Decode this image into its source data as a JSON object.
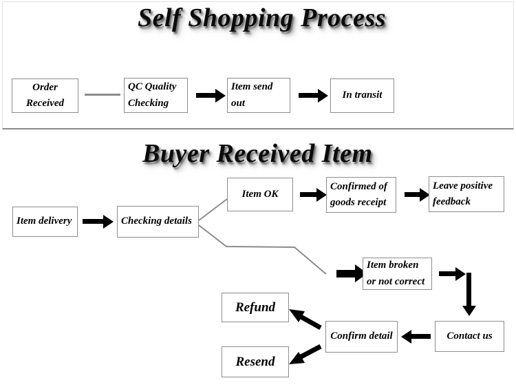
{
  "document": {
    "type": "flowchart-diagram",
    "background_color": "#ffffff",
    "box_border_color": "#8d8d8d",
    "arrow_color": "#000000",
    "connector_color": "#8b8b8b"
  },
  "sections": [
    {
      "id": "self-shopping-process",
      "title": "Self Shopping Process",
      "nodes": [
        {
          "id": "order-received",
          "lines": [
            "Order",
            "Received"
          ],
          "align": "center"
        },
        {
          "id": "qc-quality-checking",
          "lines": [
            "QC Quality",
            "Checking"
          ],
          "align": "left"
        },
        {
          "id": "item-send-out",
          "lines": [
            "Item send",
            "out"
          ],
          "align": "left"
        },
        {
          "id": "in-transit",
          "lines": [
            "In transit"
          ],
          "align": "center"
        }
      ],
      "flow": [
        {
          "from": "order-received",
          "to": "qc-quality-checking",
          "style": "plain-line"
        },
        {
          "from": "qc-quality-checking",
          "to": "item-send-out",
          "style": "arrow"
        },
        {
          "from": "item-send-out",
          "to": "in-transit",
          "style": "arrow"
        }
      ]
    },
    {
      "id": "buyer-received-item",
      "title": "Buyer Received Item",
      "nodes": [
        {
          "id": "item-delivery",
          "lines": [
            "Item delivery"
          ],
          "align": "left"
        },
        {
          "id": "checking-details",
          "lines": [
            "Checking details"
          ],
          "align": "left"
        },
        {
          "id": "item-ok",
          "lines": [
            "Item OK"
          ],
          "align": "center"
        },
        {
          "id": "confirmed-receipt",
          "lines": [
            "Confirmed of",
            "goods receipt"
          ],
          "align": "left"
        },
        {
          "id": "leave-feedback",
          "lines": [
            "Leave positive",
            "feedback"
          ],
          "align": "left"
        },
        {
          "id": "item-broken",
          "lines": [
            "Item broken",
            "or not correct"
          ],
          "align": "left"
        },
        {
          "id": "contact-us",
          "lines": [
            "Contact us"
          ],
          "align": "center"
        },
        {
          "id": "confirm-detail",
          "lines": [
            "Confirm detail"
          ],
          "align": "center"
        },
        {
          "id": "refund",
          "lines": [
            "Refund"
          ],
          "align": "center"
        },
        {
          "id": "resend",
          "lines": [
            "Resend"
          ],
          "align": "center"
        }
      ],
      "flow": [
        {
          "from": "item-delivery",
          "to": "checking-details",
          "style": "arrow"
        },
        {
          "from": "checking-details",
          "to": "item-ok",
          "style": "plain-line"
        },
        {
          "from": "item-ok",
          "to": "confirmed-receipt",
          "style": "arrow"
        },
        {
          "from": "confirmed-receipt",
          "to": "leave-feedback",
          "style": "arrow"
        },
        {
          "from": "checking-details",
          "to": "item-broken",
          "style": "plain-line-then-arrow"
        },
        {
          "from": "item-broken",
          "to": "contact-us",
          "style": "arrow-right-then-down"
        },
        {
          "from": "contact-us",
          "to": "confirm-detail",
          "style": "arrow-left"
        },
        {
          "from": "confirm-detail",
          "to": "refund",
          "style": "arrow-diagonal-up-left"
        },
        {
          "from": "confirm-detail",
          "to": "resend",
          "style": "arrow-diagonal-down-left"
        }
      ]
    }
  ]
}
